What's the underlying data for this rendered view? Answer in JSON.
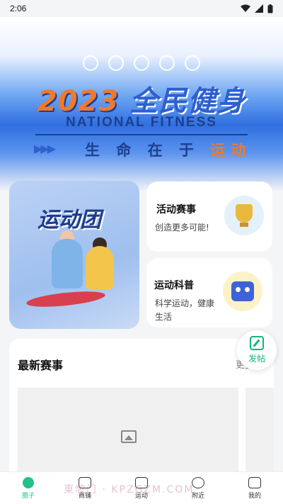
{
  "status_bar": {
    "time": "2:06"
  },
  "banner": {
    "year_title": "2023",
    "main_title": "全民健身",
    "subtitle": "NATIONAL FITNESS",
    "tag_prefix": "生 命 在 于",
    "tag_highlight": "运动",
    "arrows": "▶▶▶",
    "sport_icons": [
      "football-icon",
      "badminton-icon",
      "dumbbell-icon",
      "basketball-icon",
      "volleyball-icon"
    ]
  },
  "feature_left": {
    "title": "运动团"
  },
  "cards": [
    {
      "title": "活动赛事",
      "desc": "创造更多可能!",
      "icon": "trophy-icon"
    },
    {
      "title": "运动科普",
      "desc": "科学运动，健康生活",
      "icon": "robot-icon"
    }
  ],
  "post_button": {
    "label": "发帖"
  },
  "events": {
    "title": "最新赛事",
    "more": "更多"
  },
  "bottom_nav": [
    {
      "label": "圈子",
      "icon": "circle-icon",
      "active": true
    },
    {
      "label": "商铺",
      "icon": "shop-icon",
      "active": false
    },
    {
      "label": "运动",
      "icon": "shoe-icon",
      "active": false
    },
    {
      "label": "附近",
      "icon": "location-icon",
      "active": false
    },
    {
      "label": "我的",
      "icon": "profile-icon",
      "active": false
    }
  ],
  "watermark": "東坡门 · KPZGZM.COM",
  "colors": {
    "accent": "#22c08a",
    "banner_blue": "#2f6fe0",
    "banner_orange": "#f07a2a"
  }
}
